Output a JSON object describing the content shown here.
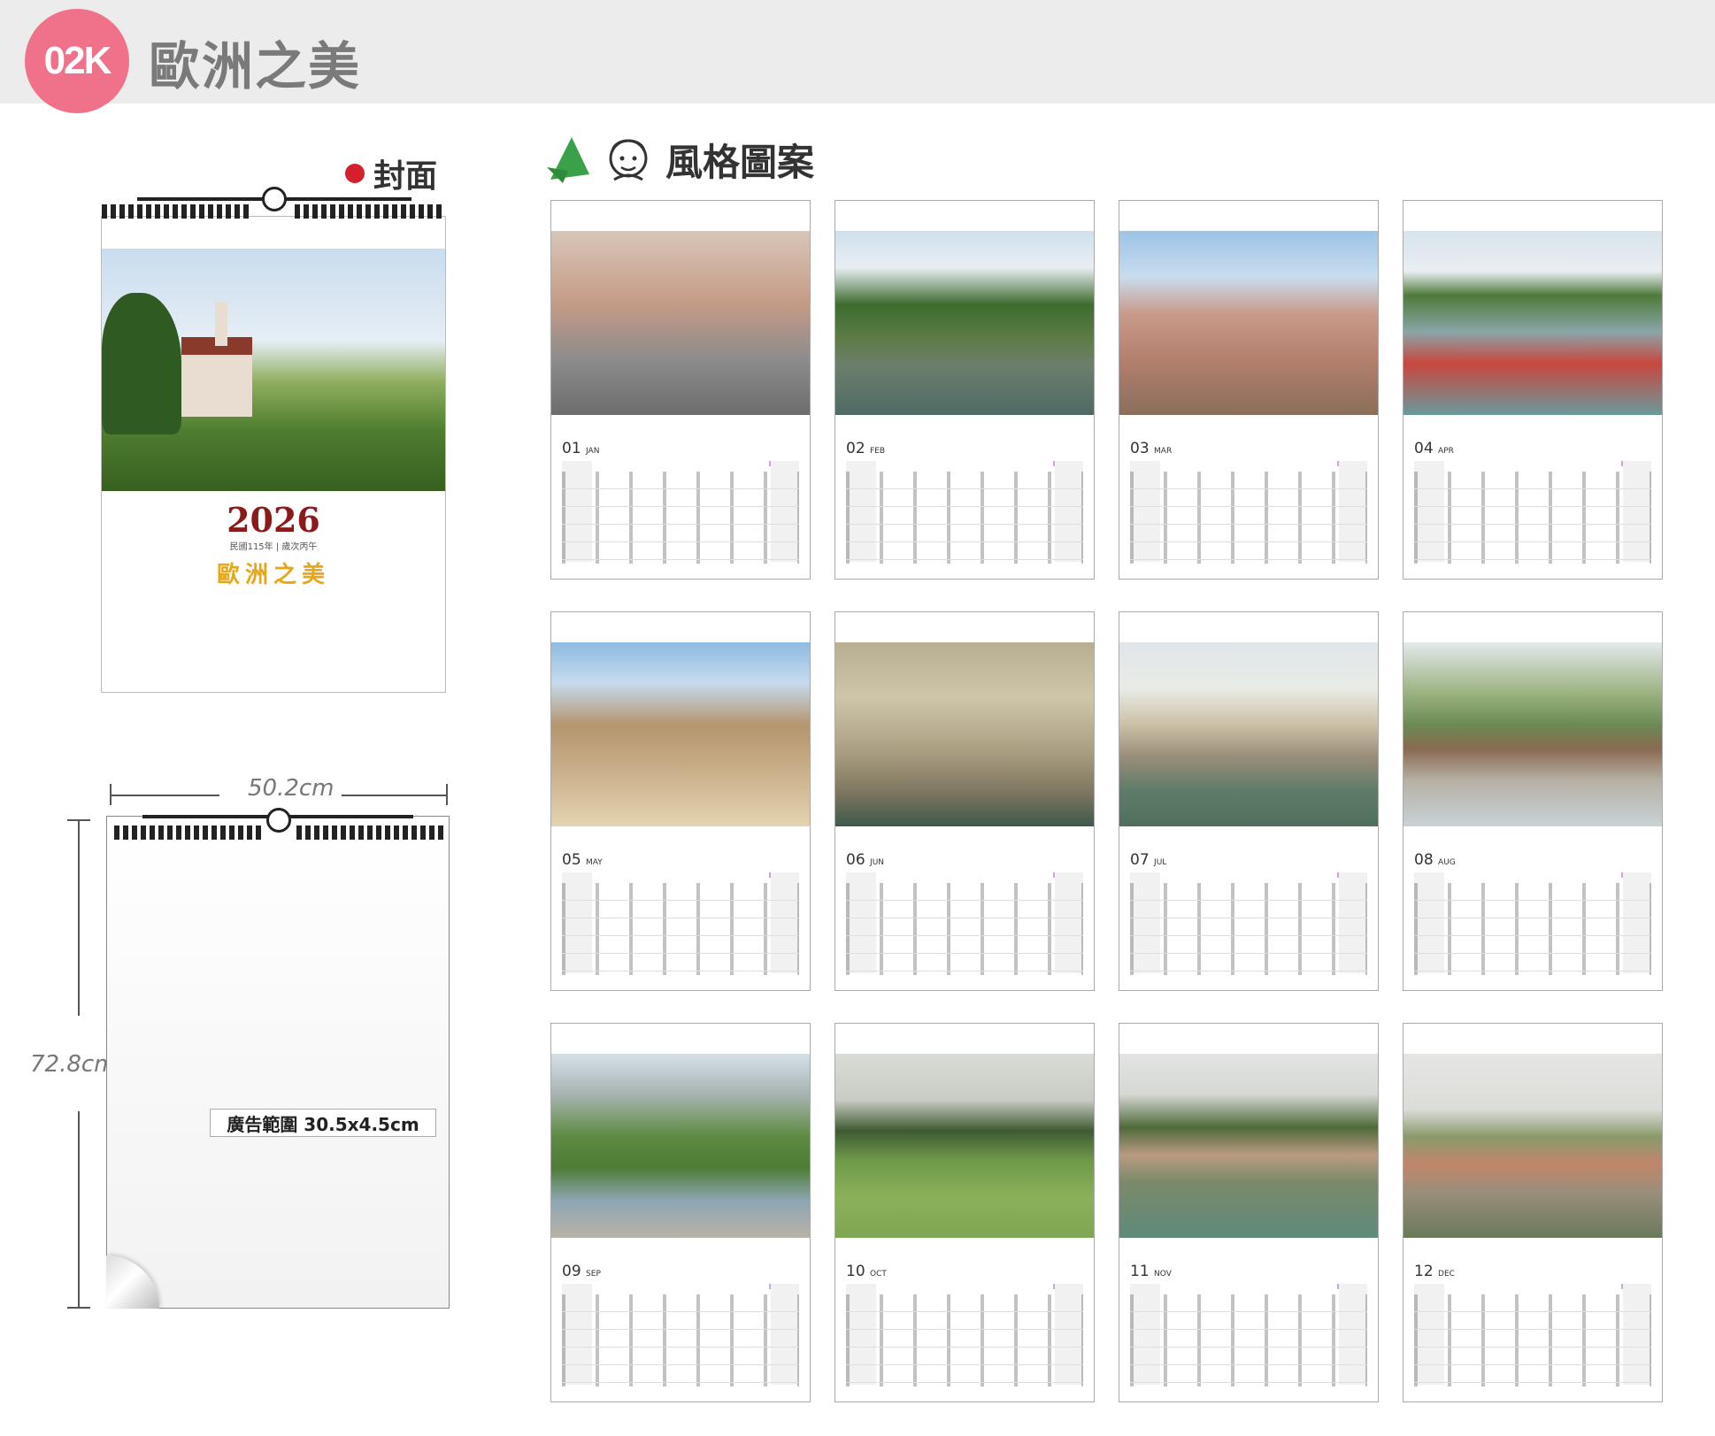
{
  "header": {
    "badge": "02K",
    "title": "歐洲之美"
  },
  "cover_section": {
    "label": "封面"
  },
  "style_section": {
    "label": "風格圖案"
  },
  "cover": {
    "year": "2026",
    "subtitle": "民國115年 | 歲次丙午",
    "name": "歐洲之美"
  },
  "dimensions": {
    "width": "50.2cm",
    "height": "72.8cm",
    "ad_area": "廣告範圍 30.5x4.5cm"
  },
  "months": [
    {
      "num": "01",
      "abbr": "JAN",
      "photo": "street-scene"
    },
    {
      "num": "02",
      "abbr": "FEB",
      "photo": "river-town"
    },
    {
      "num": "03",
      "abbr": "MAR",
      "photo": "town-square"
    },
    {
      "num": "04",
      "abbr": "APR",
      "photo": "harbor-boats"
    },
    {
      "num": "05",
      "abbr": "MAY",
      "photo": "plaza-buildings"
    },
    {
      "num": "06",
      "abbr": "JUN",
      "photo": "lion-monument"
    },
    {
      "num": "07",
      "abbr": "JUL",
      "photo": "church-river"
    },
    {
      "num": "08",
      "abbr": "AUG",
      "photo": "mountain-river"
    },
    {
      "num": "09",
      "abbr": "SEP",
      "photo": "alpine-stream"
    },
    {
      "num": "10",
      "abbr": "OCT",
      "photo": "meadow-hut"
    },
    {
      "num": "11",
      "abbr": "NOV",
      "photo": "riverside-town"
    },
    {
      "num": "12",
      "abbr": "DEC",
      "photo": "bridge-town"
    }
  ]
}
